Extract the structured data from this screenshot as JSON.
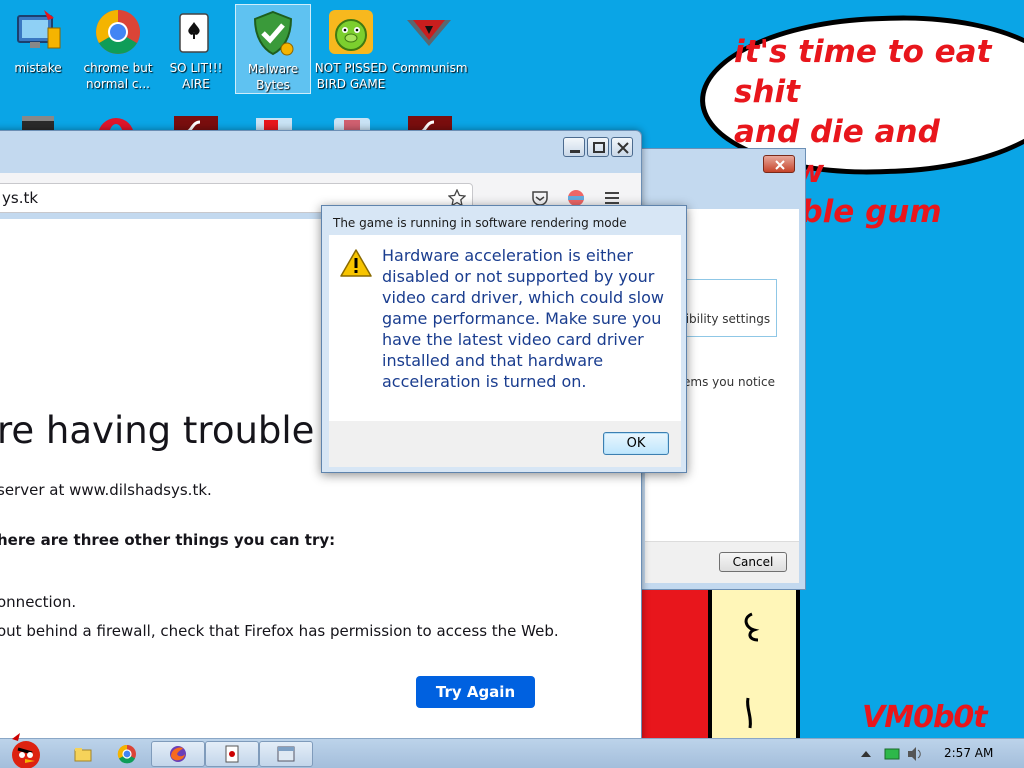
{
  "desktop": {
    "icons": [
      {
        "label": "mistake"
      },
      {
        "label": "chrome but normal c..."
      },
      {
        "label": "SO LIT!!! AIRE"
      },
      {
        "label": "Malware Bytes"
      },
      {
        "label": "NOT PISSED BIRD GAME"
      },
      {
        "label": "Communism"
      }
    ]
  },
  "overlay": {
    "bubble_text": "it's time to eat shit\nand die and chew\nbubble gum",
    "signature": "VM0b0t"
  },
  "browser": {
    "url": "ys.tk",
    "error_title": "re having trouble fin",
    "line_server": "server at www.dilshadsys.tk.",
    "line_tips": " here are three other things you can try:",
    "line_connection": "onnection.",
    "line_firewall": "out behind a firewall, check that Firefox has permission to access the Web.",
    "try_again_label": "Try Again"
  },
  "compat_window": {
    "settings_text": "tibility settings",
    "problems_text": "ems you notice",
    "cancel_label": "Cancel"
  },
  "dialog": {
    "title": "The game is running in software rendering mode",
    "message": "Hardware acceleration is either disabled or not supported by your video card driver, which could slow game performance. Make sure you have the latest video card driver installed and that hardware acceleration is turned on.",
    "ok_label": "OK"
  },
  "taskbar": {
    "clock": "2:57 AM"
  },
  "colors": {
    "desktop_bg": "#0aa5e6",
    "bubble_text": "#e8161c",
    "try_again_bg": "#0061e0",
    "dialog_text": "#1a3d8f"
  }
}
